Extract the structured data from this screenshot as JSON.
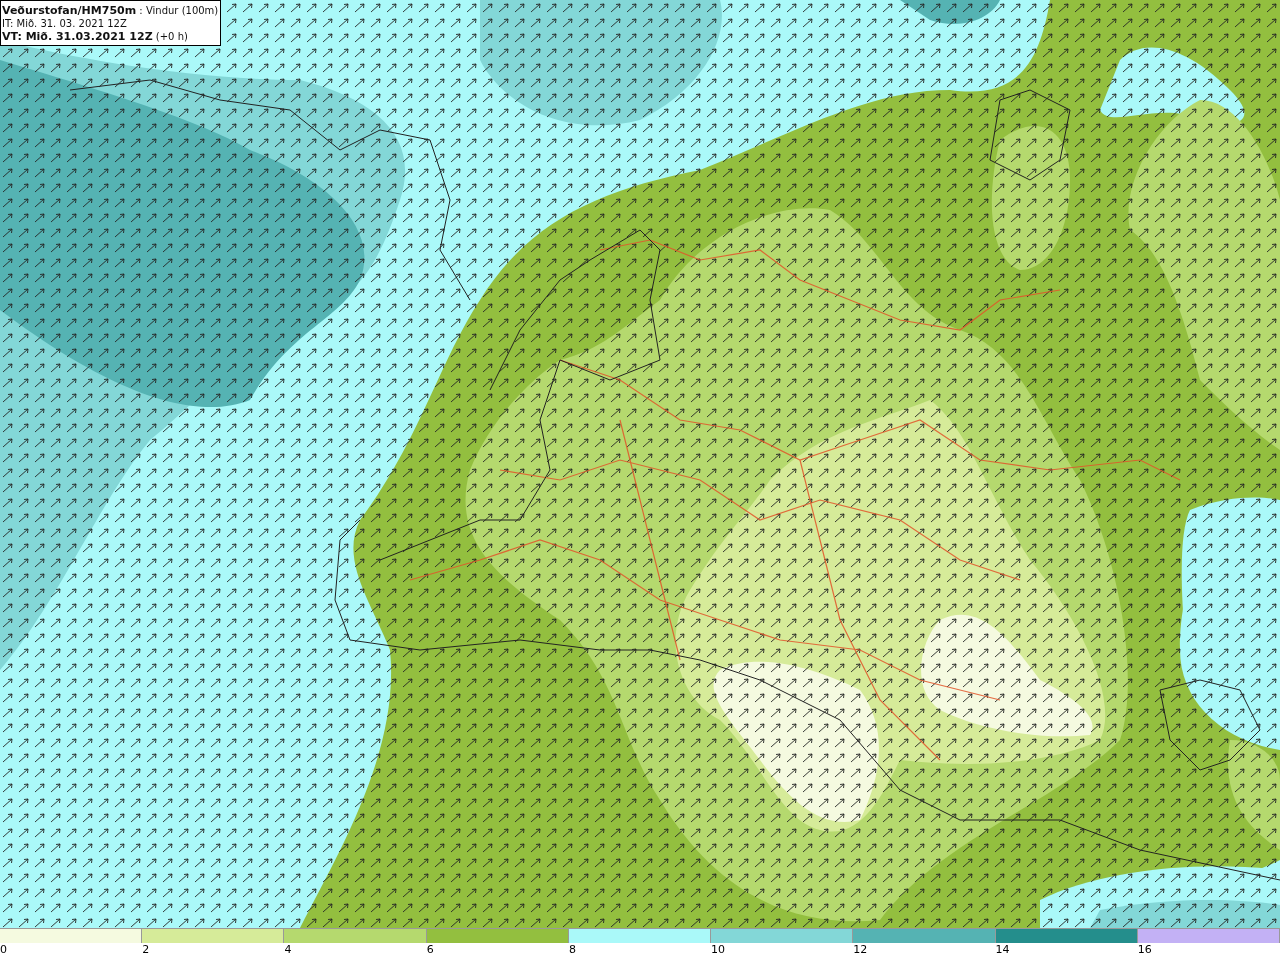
{
  "info_box": {
    "lines": [
      "**Veðurstofan/HM750m** : Vindur (100m)",
      "IT: Mið. 31. 03. 2021 12Z",
      "**VT: Mið. 31.03.2021 12Z** (+0 h)"
    ]
  },
  "legend": [
    {
      "label": "0",
      "color": "#f5fae0"
    },
    {
      "label": "2",
      "color": "#d6eb99"
    },
    {
      "label": "4",
      "color": "#b5d96e"
    },
    {
      "label": "6",
      "color": "#93bf3f"
    },
    {
      "label": "8",
      "color": "#aaf9f9"
    },
    {
      "label": "10",
      "color": "#83d7d7"
    },
    {
      "label": "12",
      "color": "#55b3b3"
    },
    {
      "label": "14",
      "color": "#248e8c"
    },
    {
      "label": "16",
      "color": "#c3b1f5"
    }
  ]
}
